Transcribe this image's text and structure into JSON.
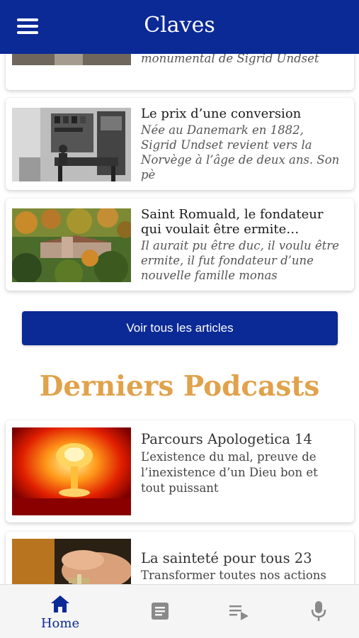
{
  "app": {
    "title": "Claves"
  },
  "articles": [
    {
      "title": "",
      "excerpt": "monumental de Sigrid Undset",
      "image": "article-photo"
    },
    {
      "title": "Le prix d’une conversion",
      "excerpt": "Née au Danemark en 1882, Sigrid Undset revient vers la Norvège à l’âge de deux ans. Son pè",
      "image": "study-room-photo"
    },
    {
      "title": "Saint Romuald, le fondateur qui voulait être ermite…",
      "excerpt": "Il aurait pu être duc, il voulu être ermite, il fut fondateur d’une nouvelle famille monas",
      "image": "monastery-landscape-photo"
    }
  ],
  "articles_line_breaks": {
    "a2_excerpt": [
      "Née au Danemark en 1882,",
      "Sigrid Undset revient vers la",
      "Norvège à l’âge de deux ans. Son",
      "pè"
    ],
    "a3_title": [
      "Saint Romuald, le fondateur",
      "qui voulait être ermite…"
    ],
    "a3_excerpt": [
      "Il aurait pu être duc, il voulu être",
      "ermite, il fut fondateur d’une",
      "nouvelle famille monas"
    ]
  },
  "buttons": {
    "all_articles": "Voir tous les articles"
  },
  "podcasts_section": {
    "heading": "Derniers Podcasts"
  },
  "podcasts": [
    {
      "title": "Parcours Apologetica 14",
      "subtitle_lines": [
        "L’existence du mal, preuve de",
        "l’inexistence d’un Dieu bon et",
        "tout puissant"
      ],
      "image": "nuclear-explosion-photo"
    },
    {
      "title": "La sainteté pour tous 23",
      "subtitle_lines": [
        "Transformer toutes nos actions"
      ],
      "image": "hands-working-photo"
    }
  ],
  "bottom_nav": [
    {
      "label": "Home",
      "icon": "home-icon",
      "active": true
    },
    {
      "label": "",
      "icon": "article-icon",
      "active": false
    },
    {
      "label": "",
      "icon": "playlist-icon",
      "active": false
    },
    {
      "label": "",
      "icon": "microphone-icon",
      "active": false
    }
  ],
  "colors": {
    "primary": "#0b2a96",
    "accent": "#e0a24b",
    "inactive_icon": "#8a8a8a"
  }
}
